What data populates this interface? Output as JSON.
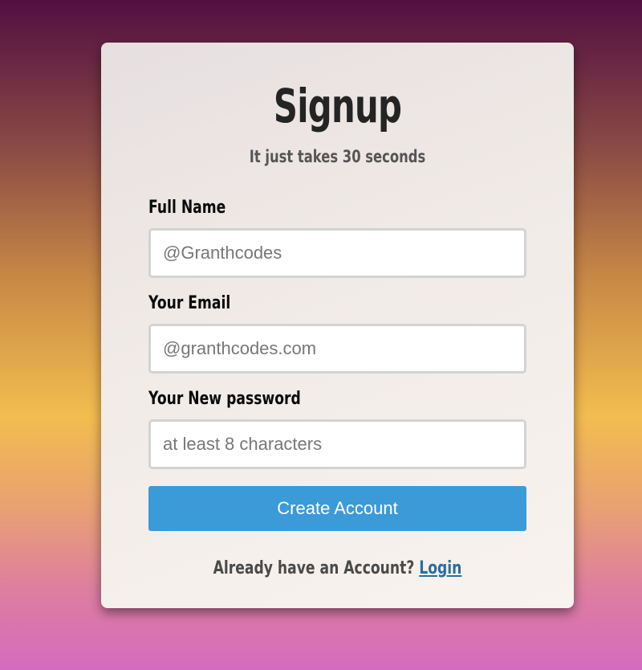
{
  "card": {
    "title": "Signup",
    "subtitle": "It just takes 30 seconds"
  },
  "form": {
    "full_name": {
      "label": "Full Name",
      "placeholder": "@Granthcodes"
    },
    "email": {
      "label": "Your Email",
      "placeholder": "@granthcodes.com"
    },
    "password": {
      "label": "Your New password",
      "placeholder": "at least 8 characters"
    },
    "submit_label": "Create Account"
  },
  "footer": {
    "prompt": "Already have an Account?",
    "login_link": "Login"
  },
  "colors": {
    "button": "#3b9ad8",
    "link": "#2b6e9e",
    "title": "#242424"
  }
}
